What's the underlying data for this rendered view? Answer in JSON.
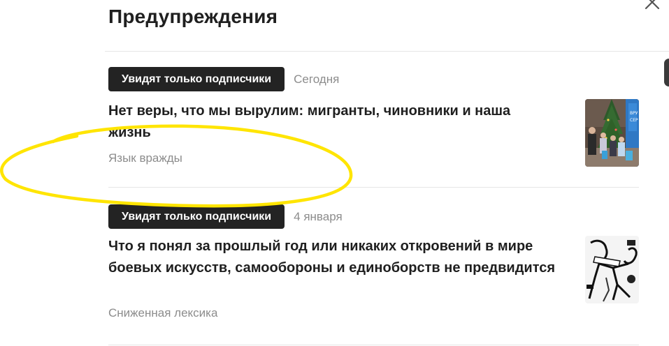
{
  "panel": {
    "title": "Предупреждения"
  },
  "items": [
    {
      "badge": "Увидят только подписчики",
      "date": "Сегодня",
      "headline": "Нет веры, что мы вырулим: мигранты, чиновники и наша жизнь",
      "reason": "Язык вражды",
      "thumbnail": "photo-people-christmas-tree"
    },
    {
      "badge": "Увидят только подписчики",
      "date": "4 января",
      "headline": "Что я понял за прошлый год или никаких откровений в мире боевых искусств, самообороны и единоборств не предвидится",
      "reason": "Сниженная лексика",
      "thumbnail": "comic-fighters-illustration"
    }
  ],
  "annotation": {
    "color": "#ffe500"
  }
}
